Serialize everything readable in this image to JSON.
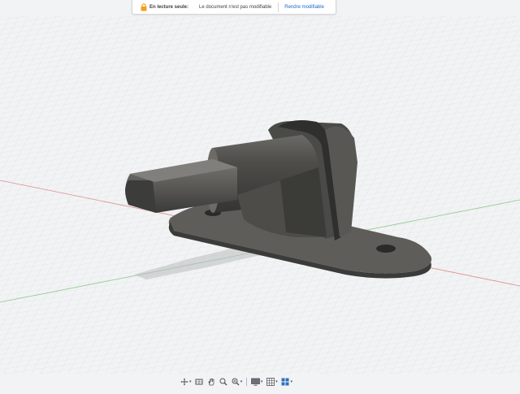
{
  "banner": {
    "title": "En lecture seule:",
    "message": "Le document n'est pas modifiable",
    "action": "Rendre modifiable"
  },
  "colors": {
    "background": "#f2f3f4",
    "grid": "#d5d8dc",
    "axis_x": "#e08c8c",
    "axis_y": "#8cc98c",
    "model": "#4a4a48",
    "banner_link": "#1b6ac9",
    "lock": "#f0a020"
  },
  "toolbar": {
    "tools": [
      {
        "icon": "orbit-icon",
        "has_menu": true
      },
      {
        "icon": "look-at-icon",
        "has_menu": false
      },
      {
        "icon": "pan-hand-icon",
        "has_menu": false
      },
      {
        "icon": "zoom-icon",
        "has_menu": false
      },
      {
        "icon": "fit-zoom-icon",
        "has_menu": true
      },
      {
        "icon": "display-settings-icon",
        "has_menu": true
      },
      {
        "icon": "grid-snap-icon",
        "has_menu": true
      },
      {
        "icon": "viewports-icon",
        "has_menu": true
      }
    ],
    "caret": "▾"
  }
}
